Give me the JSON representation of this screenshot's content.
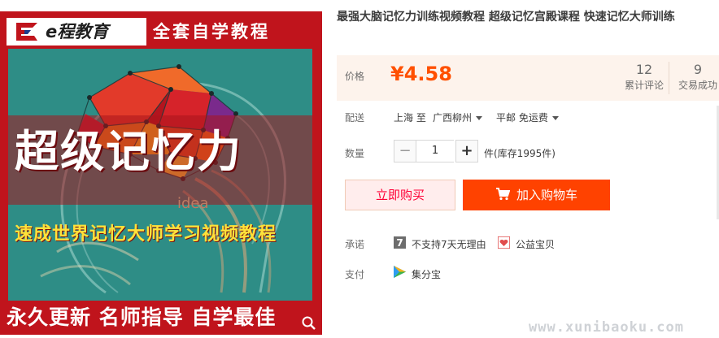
{
  "image": {
    "brand": "e程教育",
    "header_slogan": "全套自学教程",
    "main_title": "超级记忆力",
    "sub_title": "速成世界记忆大师学习视频教程",
    "idea_word": "idea",
    "footer_slogan": "永久更新 名师指导 自学最佳"
  },
  "product": {
    "title": "最强大脑记忆力训练视频教程 超级记忆宫殿课程 快速记忆大师训练"
  },
  "price": {
    "label": "价格",
    "value": "¥4.58",
    "reviews_count": "12",
    "reviews_label": "累计评论",
    "sales_count": "9",
    "sales_label": "交易成功"
  },
  "delivery": {
    "label": "配送",
    "from": "上海 至",
    "to": "广西柳州",
    "shipping": "平邮 免运费"
  },
  "quantity": {
    "label": "数量",
    "value": "1",
    "minus": "−",
    "plus": "+",
    "stock": "件(库存1995件)"
  },
  "actions": {
    "buy_now": "立即购买",
    "add_cart": "加入购物车"
  },
  "promise": {
    "label": "承诺",
    "no_return": "不支持7天无理由",
    "no_return_icon_text": "7",
    "charity": "公益宝贝"
  },
  "payment": {
    "label": "支付",
    "method": "集分宝"
  },
  "watermark": "www.xunibaoku.com",
  "colors": {
    "price": "#ff5000",
    "add_cart_bg": "#ff4200",
    "buy_now_text": "#ff0036",
    "image_red": "#c0141c",
    "image_teal": "#2e8d86",
    "sub_title_yellow": "#ffe23a"
  },
  "icons": [
    "brand-logo-icon",
    "zoom-icon",
    "caret-down-icon",
    "cart-icon",
    "no-return-7-icon",
    "charity-heart-icon",
    "jifenbao-icon"
  ]
}
